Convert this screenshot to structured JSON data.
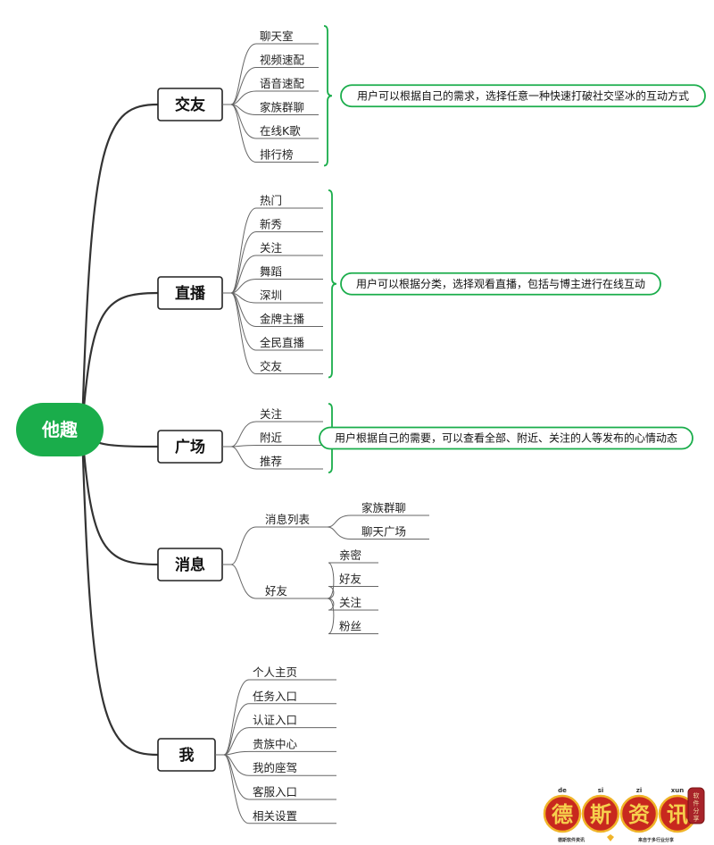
{
  "colors": {
    "accent": "#1aad4b",
    "line": "#333333",
    "leaf_line": "#666666",
    "logo_red": "#c8281e",
    "logo_gold": "#f0b429"
  },
  "root": {
    "label": "他趣"
  },
  "branches": [
    {
      "id": "jiaoyou",
      "label": "交友",
      "children": [
        "聊天室",
        "视频速配",
        "语音速配",
        "家族群聊",
        "在线K歌",
        "排行榜"
      ],
      "note": "用户可以根据自己的需求，选择任意一种快速打破社交坚冰的互动方式"
    },
    {
      "id": "zhibo",
      "label": "直播",
      "children": [
        "热门",
        "新秀",
        "关注",
        "舞蹈",
        "深圳",
        "金牌主播",
        "全民直播",
        "交友"
      ],
      "note": "用户可以根据分类，选择观看直播，包括与博主进行在线互动"
    },
    {
      "id": "guangchang",
      "label": "广场",
      "children": [
        "关注",
        "附近",
        "推荐"
      ],
      "note": "用户根据自己的需要，可以查看全部、附近、关注的人等发布的心情动态"
    },
    {
      "id": "xiaoxi",
      "label": "消息",
      "subgroups": [
        {
          "label": "消息列表",
          "children": [
            "家族群聊",
            "聊天广场"
          ]
        },
        {
          "label": "好友",
          "children": [
            "亲密",
            "好友",
            "关注",
            "粉丝"
          ]
        }
      ]
    },
    {
      "id": "wo",
      "label": "我",
      "children": [
        "个人主页",
        "任务入口",
        "认证入口",
        "贵族中心",
        "我的座驾",
        "客服入口",
        "相关设置"
      ]
    }
  ],
  "watermark": {
    "chars": [
      "德",
      "斯",
      "资",
      "讯"
    ],
    "pinyin": [
      "de",
      "si",
      "zi",
      "xun"
    ],
    "left_caption": "德斯软件资讯",
    "right_caption": "来自于多行业分享",
    "tag": "软件分享"
  }
}
